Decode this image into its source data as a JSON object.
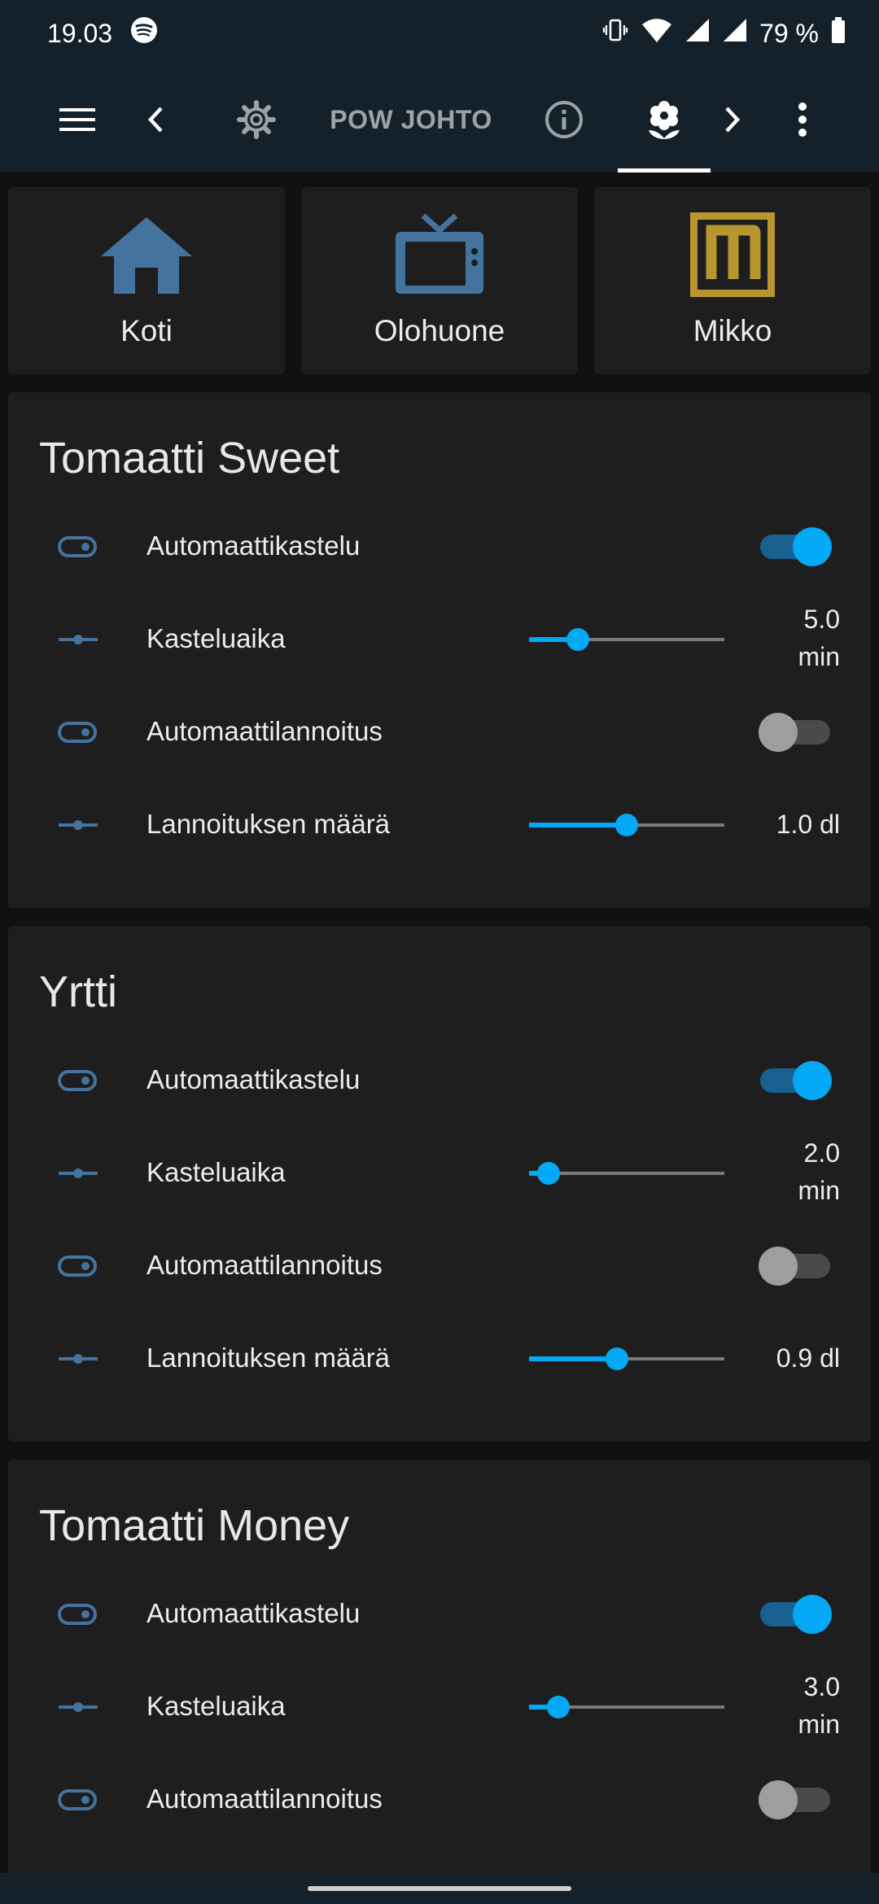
{
  "status_bar": {
    "time": "19.03",
    "battery": "79 %",
    "icons": [
      "spotify-icon",
      "vibrate-icon",
      "wifi-icon",
      "signal-icon",
      "signal-icon",
      "battery-icon"
    ]
  },
  "app_bar": {
    "title": "POW JOHTO",
    "icons": [
      "menu-icon",
      "chevron-left-icon",
      "gear-icon",
      "info-icon",
      "flower-icon",
      "chevron-right-icon",
      "more-vert-icon"
    ],
    "active_tab": "flower-icon"
  },
  "tiles": [
    {
      "label": "Koti",
      "icon": "home-icon",
      "color": "#44739e"
    },
    {
      "label": "Olohuone",
      "icon": "tv-icon",
      "color": "#44739e"
    },
    {
      "label": "Mikko",
      "icon": "mikko-logo-icon",
      "color": "#b8962e"
    }
  ],
  "cards": [
    {
      "title": "Tomaatti Sweet",
      "rows": [
        {
          "type": "toggle",
          "label": "Automaattikastelu",
          "on": true
        },
        {
          "type": "slider",
          "label": "Kasteluaika",
          "value_line1": "5.0",
          "value_line2": "min",
          "fraction": 0.25
        },
        {
          "type": "toggle",
          "label": "Automaattilannoitus",
          "on": false
        },
        {
          "type": "slider",
          "label": "Lannoituksen määrä",
          "value_line1": "1.0 dl",
          "value_line2": "",
          "fraction": 0.5
        }
      ]
    },
    {
      "title": "Yrtti",
      "rows": [
        {
          "type": "toggle",
          "label": "Automaattikastelu",
          "on": true
        },
        {
          "type": "slider",
          "label": "Kasteluaika",
          "value_line1": "2.0",
          "value_line2": "min",
          "fraction": 0.1
        },
        {
          "type": "toggle",
          "label": "Automaattilannoitus",
          "on": false
        },
        {
          "type": "slider",
          "label": "Lannoituksen määrä",
          "value_line1": "0.9 dl",
          "value_line2": "",
          "fraction": 0.45
        }
      ]
    },
    {
      "title": "Tomaatti Money",
      "rows": [
        {
          "type": "toggle",
          "label": "Automaattikastelu",
          "on": true
        },
        {
          "type": "slider",
          "label": "Kasteluaika",
          "value_line1": "3.0",
          "value_line2": "min",
          "fraction": 0.15
        },
        {
          "type": "toggle",
          "label": "Automaattilannoitus",
          "on": false
        }
      ]
    }
  ],
  "colors": {
    "accent": "#03a9f4",
    "entity_icon": "#44739e",
    "card_background": "#1e1e1e",
    "header_background": "#14202a"
  }
}
